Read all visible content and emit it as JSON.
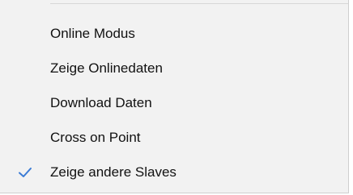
{
  "menu": {
    "items": [
      {
        "label": "Online Modus",
        "checked": false
      },
      {
        "label": "Zeige Onlinedaten",
        "checked": false
      },
      {
        "label": "Download Daten",
        "checked": false
      },
      {
        "label": "Cross on Point",
        "checked": false
      },
      {
        "label": "Zeige andere Slaves",
        "checked": true
      }
    ]
  },
  "colors": {
    "menu_background": "#f2f2f2",
    "check_accent": "#3a7bd5",
    "text": "#111111"
  },
  "icons": {
    "check": "checkmark-icon"
  }
}
